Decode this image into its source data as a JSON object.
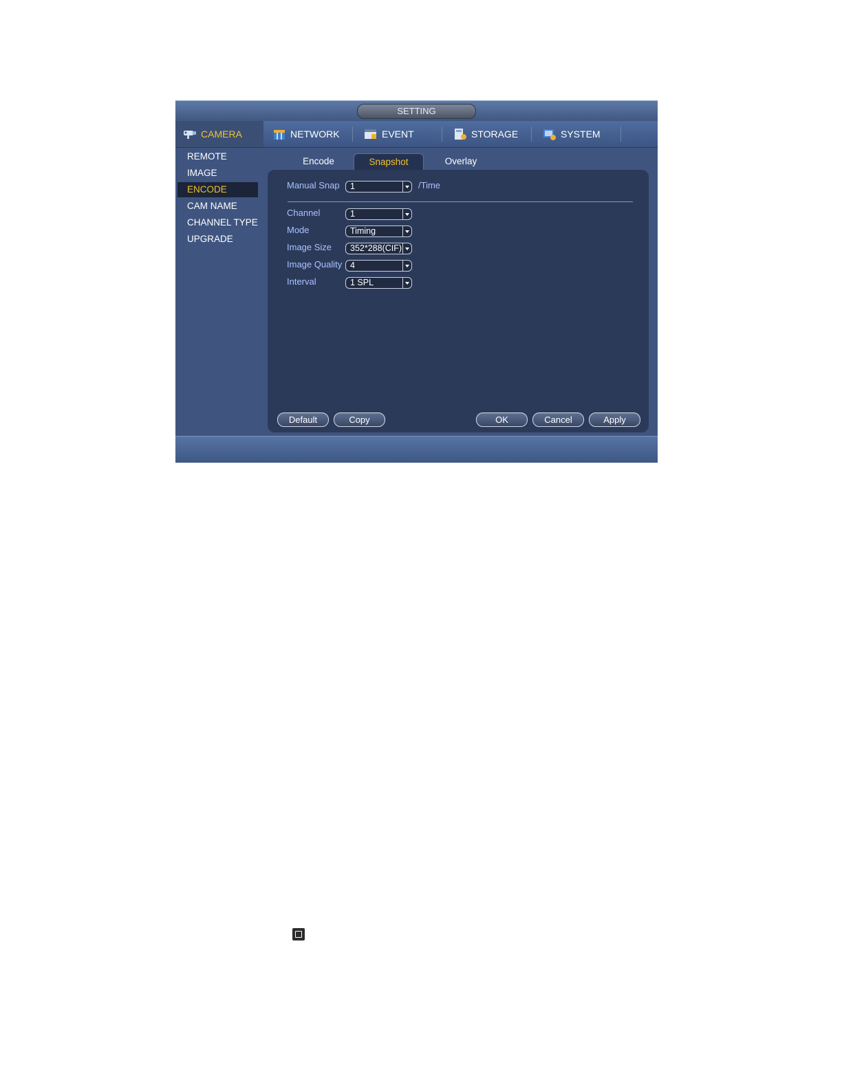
{
  "window": {
    "title": "SETTING"
  },
  "main_tabs": [
    {
      "label": "CAMERA",
      "icon": "camera-icon"
    },
    {
      "label": "NETWORK",
      "icon": "network-icon"
    },
    {
      "label": "EVENT",
      "icon": "event-icon"
    },
    {
      "label": "STORAGE",
      "icon": "storage-icon"
    },
    {
      "label": "SYSTEM",
      "icon": "system-icon"
    }
  ],
  "active_main_tab": "CAMERA",
  "sidebar": {
    "items": [
      "REMOTE",
      "IMAGE",
      "ENCODE",
      "CAM NAME",
      "CHANNEL TYPE",
      "UPGRADE"
    ],
    "active": "ENCODE"
  },
  "sub_tabs": [
    "Encode",
    "Snapshot",
    "Overlay"
  ],
  "active_sub_tab": "Snapshot",
  "form": {
    "manual_snap": {
      "label": "Manual Snap",
      "value": "1",
      "suffix": "/Time"
    },
    "channel": {
      "label": "Channel",
      "value": "1"
    },
    "mode": {
      "label": "Mode",
      "value": "Timing"
    },
    "image_size": {
      "label": "Image Size",
      "value": "352*288(CIF)"
    },
    "image_quality": {
      "label": "Image Quality",
      "value": "4"
    },
    "interval": {
      "label": "Interval",
      "value": "1 SPL"
    }
  },
  "buttons": {
    "default": "Default",
    "copy": "Copy",
    "ok": "OK",
    "cancel": "Cancel",
    "apply": "Apply"
  },
  "colors": {
    "active_text": "#f2c230",
    "label_text": "#a9c3ff",
    "window_bg": "#3f5580",
    "panel_bg": "#2c3a5a"
  }
}
